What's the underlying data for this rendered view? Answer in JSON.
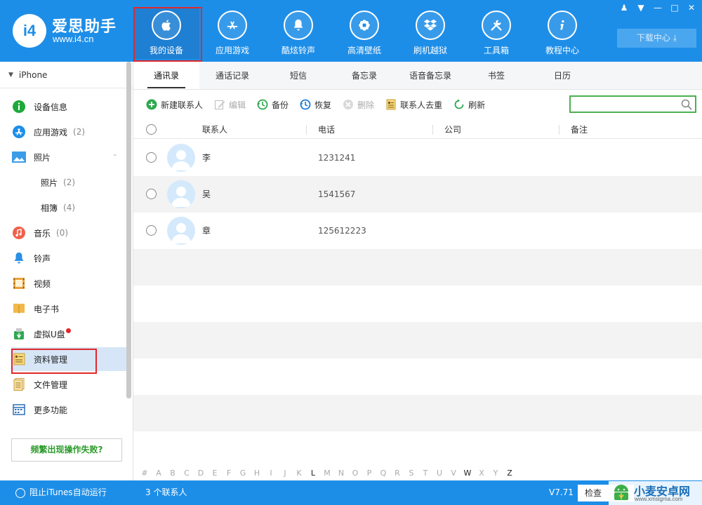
{
  "app": {
    "logo_mark": "i4",
    "name": "爱思助手",
    "url": "www.i4.cn"
  },
  "nav": [
    {
      "label": "我的设备",
      "icon": "apple-icon"
    },
    {
      "label": "应用游戏",
      "icon": "app-store-icon"
    },
    {
      "label": "酷炫铃声",
      "icon": "bell-icon"
    },
    {
      "label": "高清壁纸",
      "icon": "flower-icon"
    },
    {
      "label": "刷机越狱",
      "icon": "dropbox-icon"
    },
    {
      "label": "工具箱",
      "icon": "tools-icon"
    },
    {
      "label": "教程中心",
      "icon": "info-icon"
    }
  ],
  "download_label": "下载中心",
  "sidebar": {
    "device": "iPhone",
    "items": [
      {
        "label": "设备信息",
        "count": ""
      },
      {
        "label": "应用游戏",
        "count": "(2)"
      },
      {
        "label": "照片",
        "count": ""
      },
      {
        "label": "照片",
        "count": "(2)"
      },
      {
        "label": "相簿",
        "count": "(4)"
      },
      {
        "label": "音乐",
        "count": "(0)"
      },
      {
        "label": "铃声",
        "count": ""
      },
      {
        "label": "视频",
        "count": ""
      },
      {
        "label": "电子书",
        "count": ""
      },
      {
        "label": "虚拟U盘",
        "count": ""
      },
      {
        "label": "资料管理",
        "count": ""
      },
      {
        "label": "文件管理",
        "count": ""
      },
      {
        "label": "更多功能",
        "count": ""
      }
    ],
    "help_button": "频繁出现操作失败?"
  },
  "tabs": [
    "通讯录",
    "通话记录",
    "短信",
    "备忘录",
    "语音备忘录",
    "书签",
    "日历"
  ],
  "toolbar": {
    "new": "新建联系人",
    "edit": "编辑",
    "backup": "备份",
    "restore": "恢复",
    "delete": "删除",
    "dedupe": "联系人去重",
    "refresh": "刷新"
  },
  "table": {
    "headers": {
      "contact": "联系人",
      "phone": "电话",
      "company": "公司",
      "note": "备注"
    },
    "rows": [
      {
        "name": "李",
        "phone": "1231241"
      },
      {
        "name": "吴",
        "phone": "1541567"
      },
      {
        "name": "章",
        "phone": "125612223"
      }
    ]
  },
  "alphabet": [
    "#",
    "A",
    "B",
    "C",
    "D",
    "E",
    "F",
    "G",
    "H",
    "I",
    "J",
    "K",
    "L",
    "M",
    "N",
    "O",
    "P",
    "Q",
    "R",
    "S",
    "T",
    "U",
    "V",
    "W",
    "X",
    "Y",
    "Z"
  ],
  "alphabet_active": [
    "L",
    "W",
    "Z"
  ],
  "status": {
    "itunes": "阻止iTunes自动运行",
    "count": "3 个联系人",
    "version": "V7.71",
    "check": "检查"
  },
  "watermark": {
    "title": "小麦安卓网",
    "url": "www.xmsigma.com"
  }
}
